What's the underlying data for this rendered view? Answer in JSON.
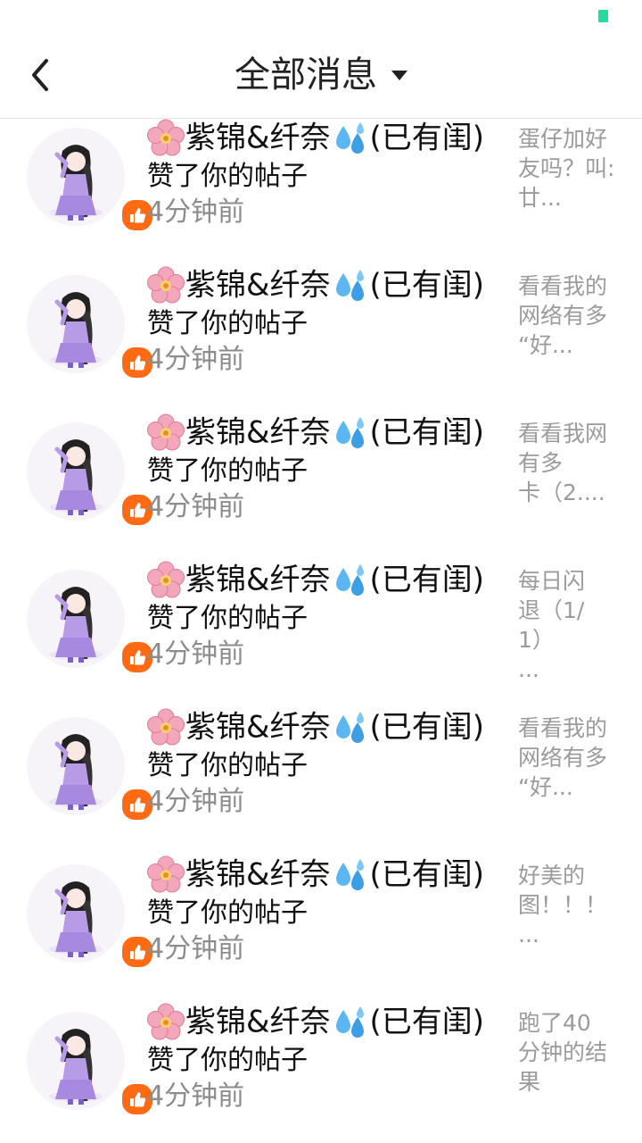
{
  "header": {
    "title": "全部消息"
  },
  "colors": {
    "accent": "#ff6a13",
    "status_indicator": "#27d9a0",
    "avatar_dress": "#b79be6"
  },
  "messages": [
    {
      "user": "紫锦&纤奈",
      "user_suffix": "(已有闺)",
      "action": "赞了你的帖子",
      "time": "4分钟前",
      "preview": "蛋仔加好\n友吗？叫:\n廿..."
    },
    {
      "user": "紫锦&纤奈",
      "user_suffix": "(已有闺)",
      "action": "赞了你的帖子",
      "time": "4分钟前",
      "preview": "看看我的\n网络有多\n“好..."
    },
    {
      "user": "紫锦&纤奈",
      "user_suffix": "(已有闺)",
      "action": "赞了你的帖子",
      "time": "4分钟前",
      "preview": "看看我网\n有多\n卡（2...."
    },
    {
      "user": "紫锦&纤奈",
      "user_suffix": "(已有闺)",
      "action": "赞了你的帖子",
      "time": "4分钟前",
      "preview": "每日闪\n退（1/1）\n..."
    },
    {
      "user": "紫锦&纤奈",
      "user_suffix": "(已有闺)",
      "action": "赞了你的帖子",
      "time": "4分钟前",
      "preview": "看看我的\n网络有多\n“好..."
    },
    {
      "user": "紫锦&纤奈",
      "user_suffix": "(已有闺)",
      "action": "赞了你的帖子",
      "time": "4分钟前",
      "preview": "好美的\n图！！！\n..."
    },
    {
      "user": "紫锦&纤奈",
      "user_suffix": "(已有闺)",
      "action": "赞了你的帖子",
      "time": "4分钟前",
      "preview": "跑了40\n分钟的结\n果"
    }
  ]
}
